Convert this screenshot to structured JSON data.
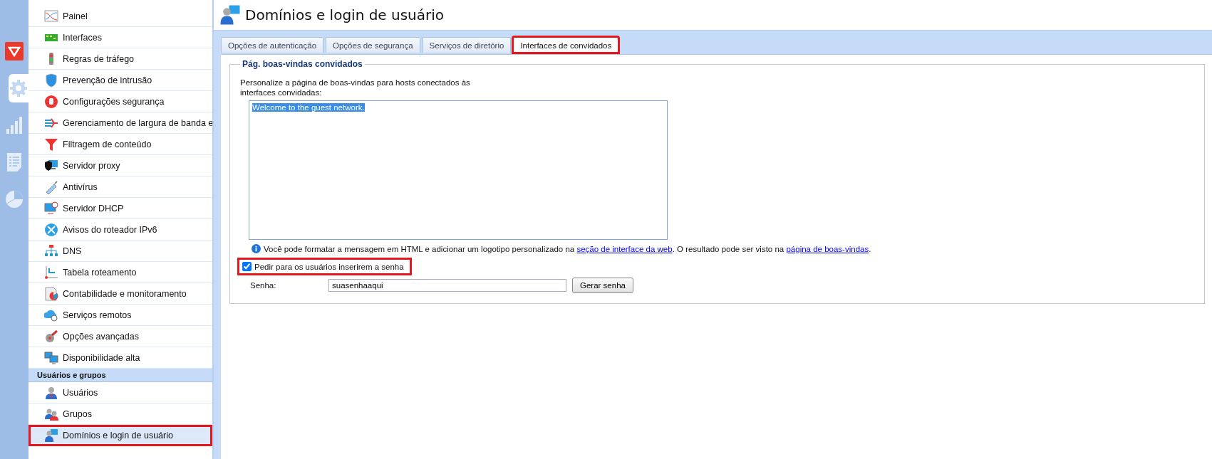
{
  "rail": {
    "items": [
      {
        "selected": false
      },
      {
        "selected": true
      },
      {
        "selected": false
      },
      {
        "selected": false
      },
      {
        "selected": false
      }
    ]
  },
  "sidebar": {
    "groups": [
      {
        "items": [
          {
            "label": "Painel",
            "selected": false,
            "highlighted": false
          },
          {
            "label": "Interfaces",
            "selected": false,
            "highlighted": false
          },
          {
            "label": "Regras de tráfego",
            "selected": false,
            "highlighted": false
          },
          {
            "label": "Prevenção de intrusão",
            "selected": false,
            "highlighted": false
          },
          {
            "label": "Configurações segurança",
            "selected": false,
            "highlighted": false
          },
          {
            "label": "Gerenciamento de largura de banda e",
            "selected": false,
            "highlighted": false
          },
          {
            "label": "Filtragem de conteúdo",
            "selected": false,
            "highlighted": false
          },
          {
            "label": "Servidor proxy",
            "selected": false,
            "highlighted": false
          },
          {
            "label": "Antivírus",
            "selected": false,
            "highlighted": false
          },
          {
            "label": "Servidor DHCP",
            "selected": false,
            "highlighted": false
          },
          {
            "label": "Avisos do roteador IPv6",
            "selected": false,
            "highlighted": false
          },
          {
            "label": "DNS",
            "selected": false,
            "highlighted": false
          },
          {
            "label": "Tabela roteamento",
            "selected": false,
            "highlighted": false
          },
          {
            "label": "Contabilidade e monitoramento",
            "selected": false,
            "highlighted": false
          },
          {
            "label": "Serviços remotos",
            "selected": false,
            "highlighted": false
          },
          {
            "label": "Opções avançadas",
            "selected": false,
            "highlighted": false
          },
          {
            "label": "Disponibilidade alta",
            "selected": false,
            "highlighted": false
          }
        ]
      },
      {
        "title": "Usuários e grupos",
        "items": [
          {
            "label": "Usuários",
            "selected": false,
            "highlighted": false
          },
          {
            "label": "Grupos",
            "selected": false,
            "highlighted": false
          },
          {
            "label": "Domínios e login de usuário",
            "selected": true,
            "highlighted": true
          }
        ]
      }
    ]
  },
  "page": {
    "title": "Domínios e login de usuário",
    "tabs": [
      {
        "label": "Opções de autenticação",
        "selected": false,
        "highlighted": false
      },
      {
        "label": "Opções de segurança",
        "selected": false,
        "highlighted": false
      },
      {
        "label": "Serviços de diretório",
        "selected": false,
        "highlighted": false
      },
      {
        "label": "Interfaces de convidados",
        "selected": true,
        "highlighted": true
      }
    ],
    "fieldset": {
      "legend": "Pág. boas-vindas convidados",
      "description": "Personalize a página de boas-vindas para hosts conectados às interfaces convidadas:",
      "message": {
        "value": "Welcome to the guest network.",
        "text_selected": true
      },
      "info": [
        {
          "kind": "text",
          "text": "Você pode formatar a mensagem em HTML e adicionar um logotipo personalizado na "
        },
        {
          "kind": "link",
          "text": "seção de interface da web"
        },
        {
          "kind": "text",
          "text": ". O resultado pode ser visto na "
        },
        {
          "kind": "link",
          "text": "página de boas-vindas"
        },
        {
          "kind": "text",
          "text": "."
        }
      ],
      "require_password": {
        "label": "Pedir para os usuários inserirem a senha",
        "checked": true,
        "highlighted": true
      },
      "password": {
        "label": "Senha:",
        "value": "suasenhaaqui",
        "button": "Gerar senha"
      }
    }
  }
}
